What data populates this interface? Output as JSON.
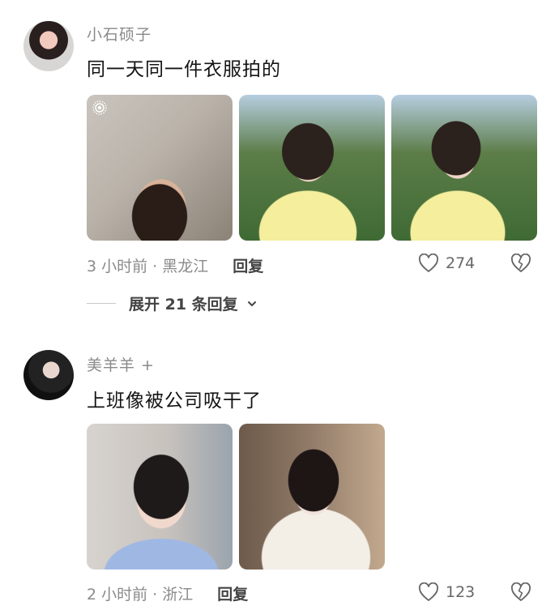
{
  "comments": [
    {
      "username": "小石硕子",
      "text": "同一天同一件衣服拍的",
      "photos": [
        "photo-car-selfie",
        "photo-yellow-dress-1",
        "photo-yellow-dress-2"
      ],
      "time_location": "3 小时前 · 黑龙江",
      "reply_label": "回复",
      "like_count": "274",
      "expand_label": "展开 21 条回复"
    },
    {
      "username": "美羊羊 +",
      "text": "上班像被公司吸干了",
      "photos": [
        "photo-office-selfie",
        "photo-white-qipao"
      ],
      "time_location": "2 小时前 · 浙江",
      "reply_label": "回复",
      "like_count": "123"
    }
  ],
  "icons": {
    "like": "heart-outline-icon",
    "dislike": "broken-heart-icon",
    "expand": "chevron-down-icon",
    "live_photo": "live-photo-icon"
  }
}
